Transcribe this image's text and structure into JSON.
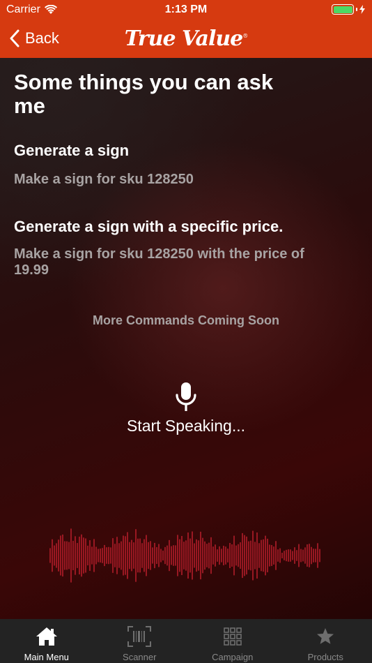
{
  "status_bar": {
    "carrier": "Carrier",
    "time": "1:13 PM"
  },
  "nav": {
    "back_label": "Back",
    "logo_text": "True Value"
  },
  "content": {
    "title": "Some things you can ask me",
    "commands": [
      {
        "title": "Generate a sign",
        "example": "Make a sign for sku 128250"
      },
      {
        "title": "Generate a sign with a specific price.",
        "example": "Make a sign for sku 128250 with the price of 19.99"
      }
    ],
    "coming_soon": "More Commands Coming Soon",
    "speak_label": "Start Speaking..."
  },
  "tabs": [
    {
      "label": "Main Menu",
      "icon": "home-icon",
      "active": true
    },
    {
      "label": "Scanner",
      "icon": "barcode-icon",
      "active": false
    },
    {
      "label": "Campaign",
      "icon": "grid-icon",
      "active": false
    },
    {
      "label": "Products",
      "icon": "star-icon",
      "active": false
    }
  ],
  "colors": {
    "header": "#d63a10",
    "wave": "#c4202e",
    "battery": "#4cd964",
    "tab_bar": "#232323"
  }
}
